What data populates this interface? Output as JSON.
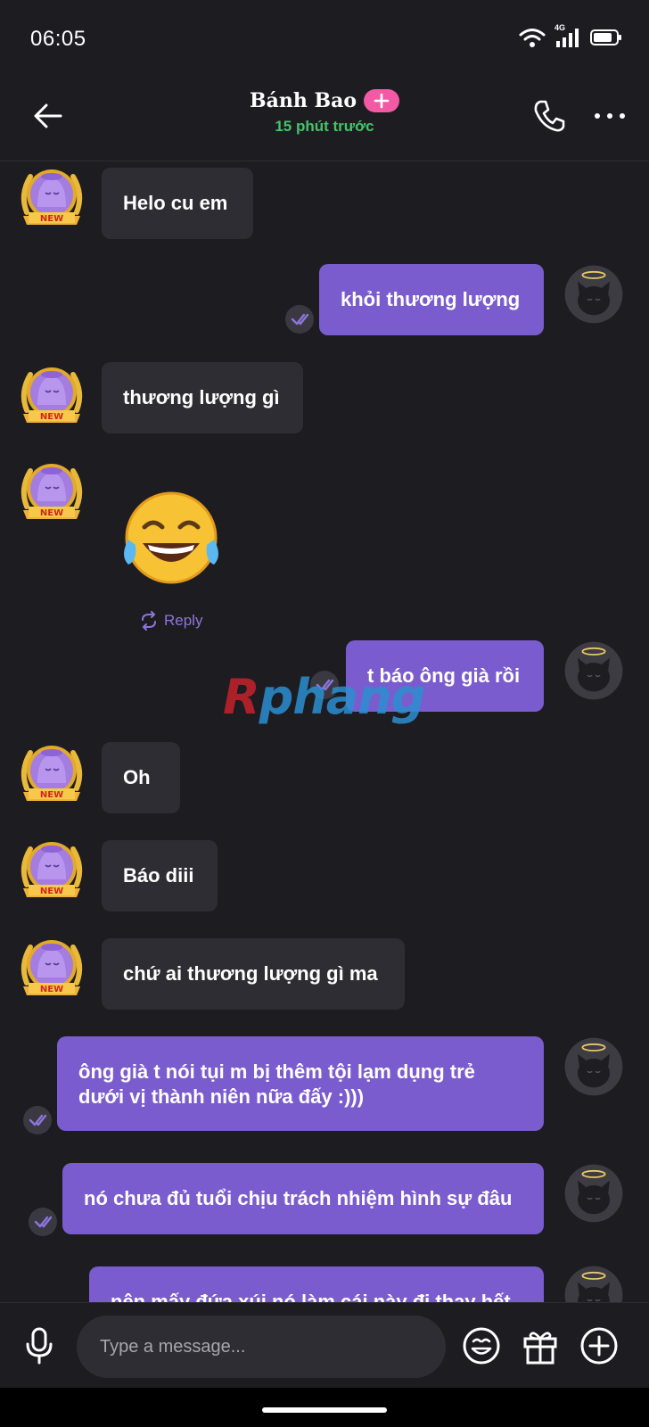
{
  "status_bar": {
    "time": "06:05",
    "network": "4G"
  },
  "header": {
    "contact_name": "Bánh Bao",
    "last_seen": "15 phút trước"
  },
  "messages": [
    {
      "dir": "in",
      "text": "Helo cu em"
    },
    {
      "dir": "out",
      "text": "khỏi thương lượng"
    },
    {
      "dir": "in",
      "text": "thương lượng gì"
    },
    {
      "dir": "in",
      "emoji": "😂"
    },
    {
      "dir": "out",
      "text": "t báo ông già rồi"
    },
    {
      "dir": "in",
      "text": "Oh"
    },
    {
      "dir": "in",
      "text": "Báo diii"
    },
    {
      "dir": "in",
      "text": "chứ ai thương lượng gì ma"
    },
    {
      "dir": "out",
      "text": "ông già t nói tụi m bị thêm tội lạm dụng trẻ dưới vị thành niên nữa đấy :)))"
    },
    {
      "dir": "out",
      "text": "nó chưa đủ tuổi chịu trách nhiệm hình sự đâu"
    },
    {
      "dir": "out",
      "text": "nên mấy đứa xúi nó làm cái này đi thay hết"
    }
  ],
  "avatar_badge": "NEW",
  "reply_label": "Reply",
  "watermark": {
    "first": "R",
    "rest": "phang"
  },
  "composer": {
    "placeholder": "Type a message..."
  },
  "colors": {
    "background": "#1d1c21",
    "incoming_bubble": "#2e2d33",
    "outgoing_bubble": "#7b5ccf",
    "online_green": "#45c36b",
    "add_badge": "#f35aa5",
    "accent": "#8c76dc"
  },
  "icons": [
    "back-arrow-icon",
    "add-plus-icon",
    "phone-icon",
    "more-dots-icon",
    "seen-double-check-icon",
    "reply-icon",
    "microphone-icon",
    "emoji-face-icon",
    "gift-icon",
    "plus-circle-icon",
    "wifi-icon",
    "signal-icon",
    "battery-icon"
  ]
}
